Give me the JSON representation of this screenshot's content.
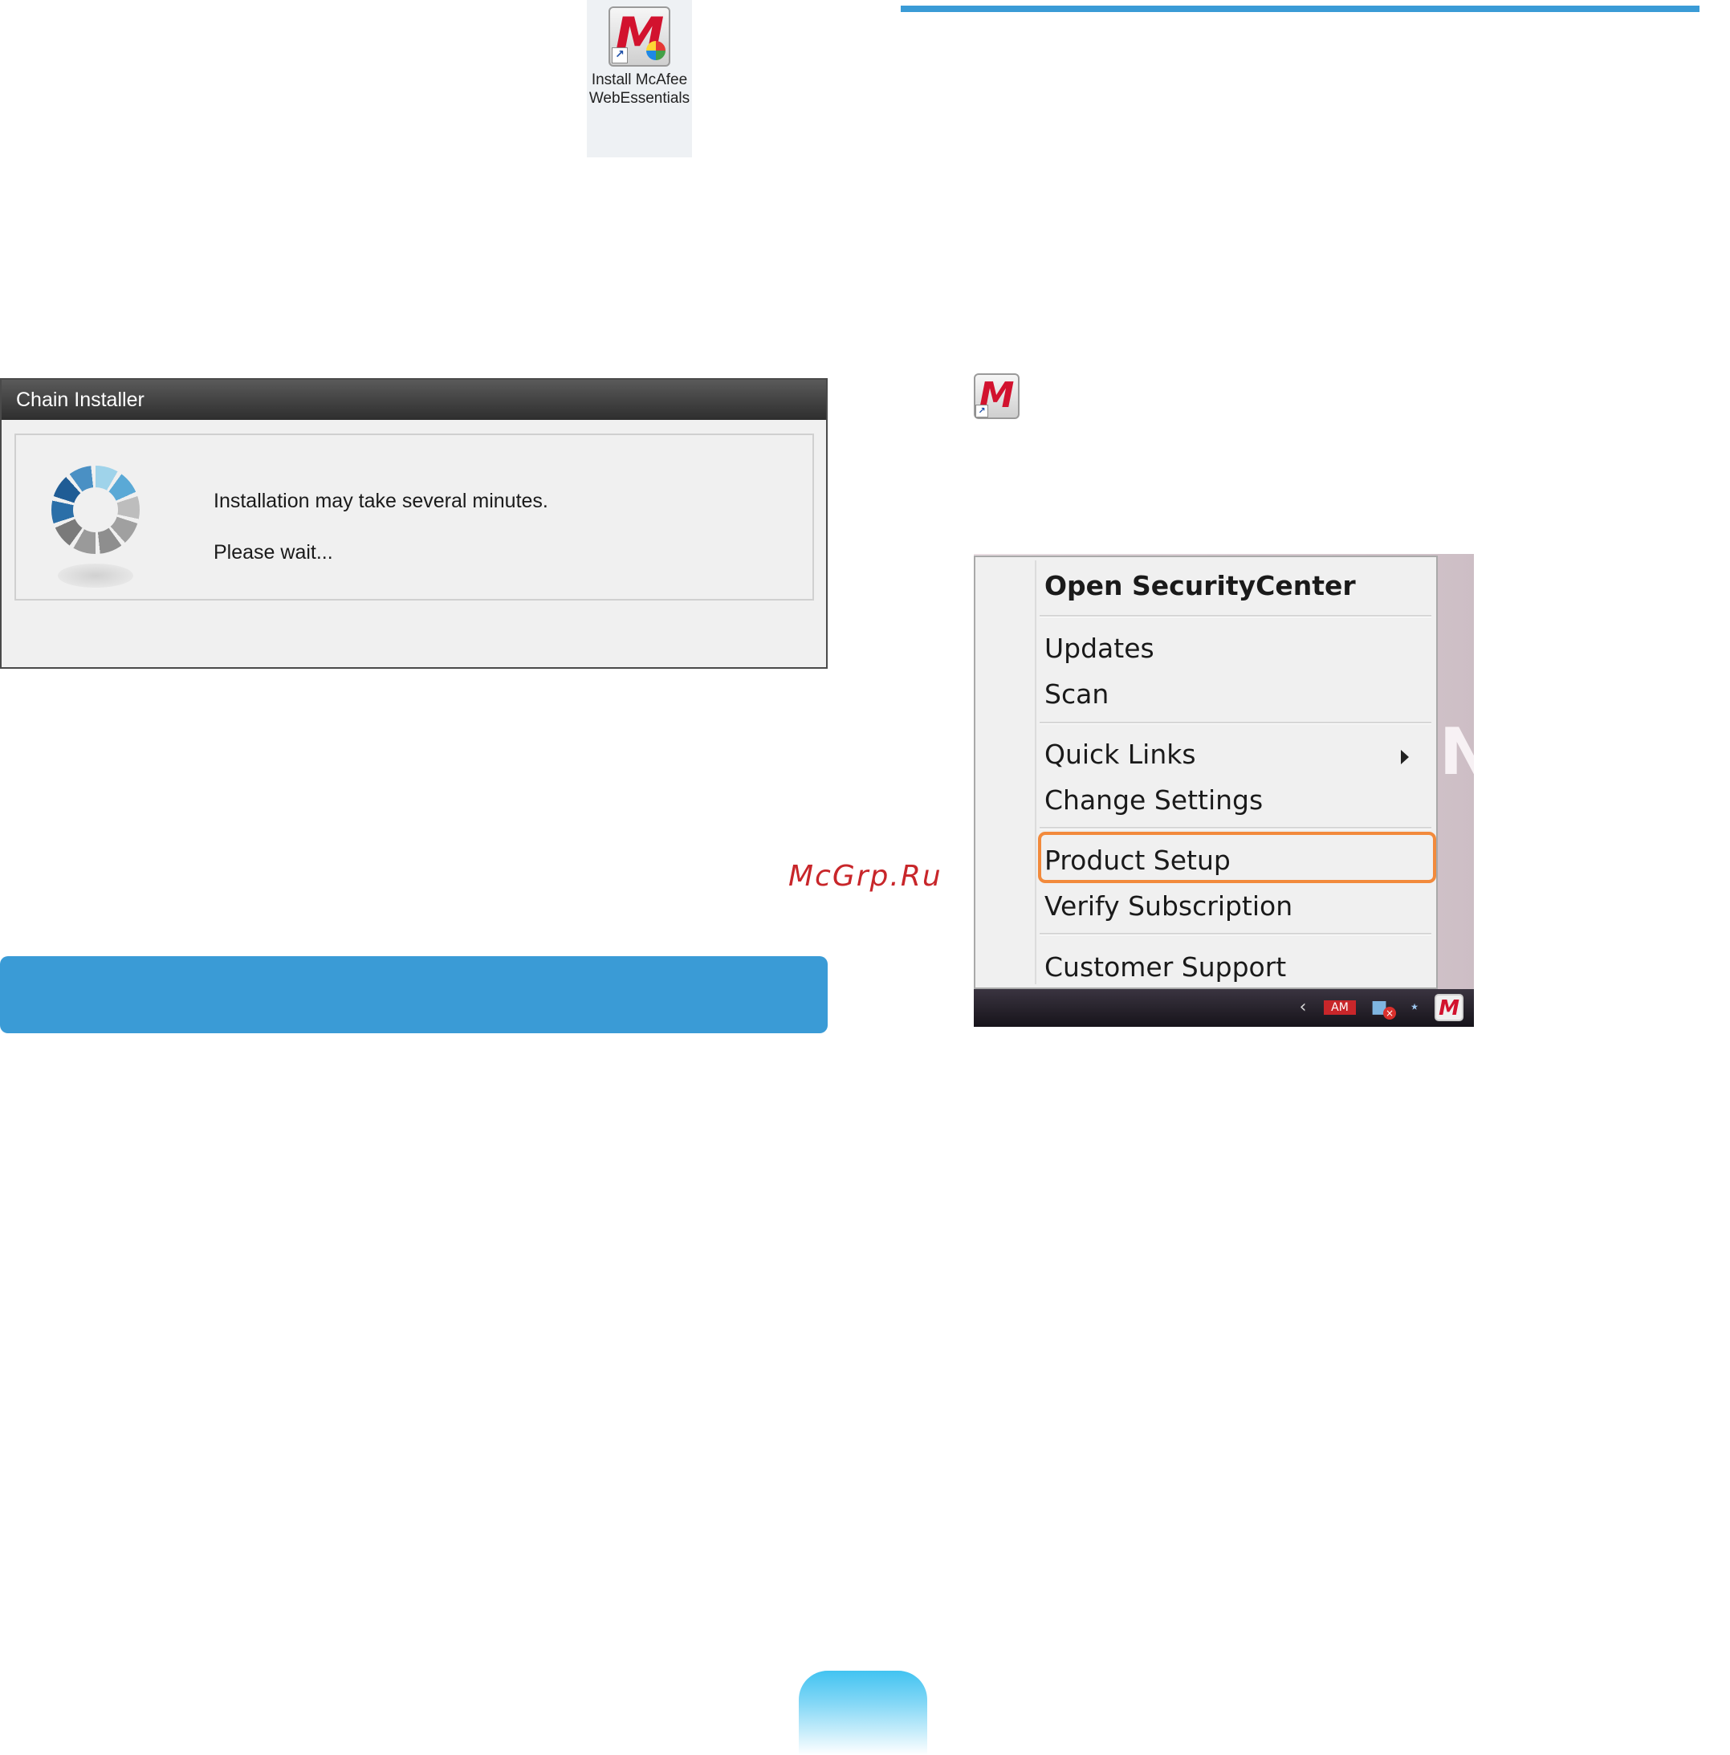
{
  "desktop_shortcut": {
    "logo_letter": "M",
    "label": "Install McAfee WebEssentials"
  },
  "installer": {
    "title": "Chain Installer",
    "message": "Installation may take several minutes.",
    "wait_text": "Please wait..."
  },
  "watermark": "McGrp.Ru",
  "small_icon": {
    "logo_letter": "M"
  },
  "context_menu": {
    "items": [
      "Open SecurityCenter",
      "Updates",
      "Scan",
      "Quick Links",
      "Change Settings",
      "Product Setup",
      "Verify Subscription",
      "Customer Support"
    ],
    "highlighted": "Product Setup"
  },
  "taskbar": {
    "tray_logo_letter": "M",
    "tray_red_icon": "AM",
    "icons": [
      "chevron-left-icon",
      "network-icon",
      "error-x-icon",
      "bluetooth-icon",
      "mcafee-tray-icon"
    ]
  },
  "colors": {
    "accent_blue": "#3a9bd6",
    "mcafee_red": "#d2122e",
    "highlight_orange": "#f28a3c",
    "watermark_red": "#c8262a"
  }
}
